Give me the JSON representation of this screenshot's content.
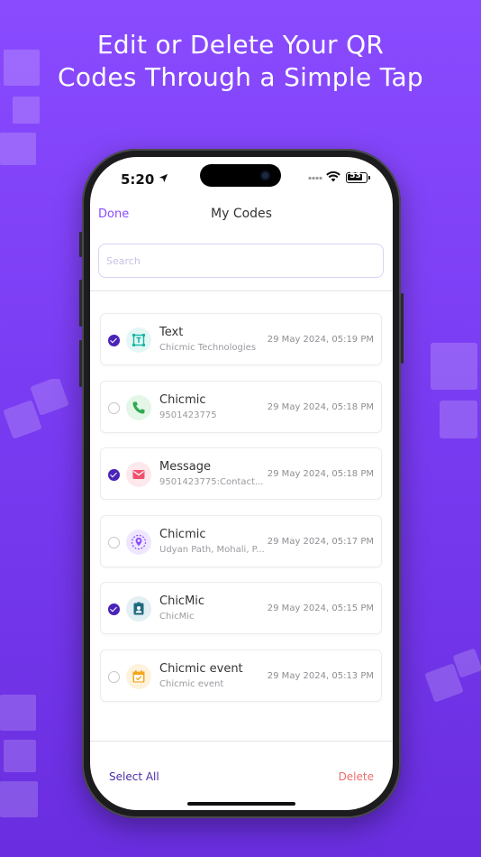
{
  "headline": {
    "line1": "Edit or Delete Your QR",
    "line2": "Codes Through a Simple Tap"
  },
  "status_bar": {
    "time": "5:20",
    "battery": "53",
    "icons": [
      "location-arrow-icon",
      "signal-icon",
      "wifi-icon",
      "battery-icon"
    ]
  },
  "nav": {
    "done_label": "Done",
    "title": "My Codes"
  },
  "search": {
    "placeholder": "Search",
    "value": ""
  },
  "codes": [
    {
      "title": "Text",
      "subtitle": "Chicmic Technologies",
      "date": "29 May 2024, 05:19 PM",
      "selected": true,
      "icon": "text-icon",
      "icon_color": "#19b5a6",
      "icon_bg": "#e4f7f5"
    },
    {
      "title": "Chicmic",
      "subtitle": "9501423775",
      "date": "29 May 2024, 05:18 PM",
      "selected": false,
      "icon": "phone-icon",
      "icon_color": "#2fa84f",
      "icon_bg": "#e3f6e7"
    },
    {
      "title": "Message",
      "subtitle": "9501423775:Contact...",
      "date": "29 May 2024, 05:18 PM",
      "selected": true,
      "icon": "message-icon",
      "icon_color": "#f0506e",
      "icon_bg": "#fde8ec"
    },
    {
      "title": "Chicmic",
      "subtitle": "Udyan Path, Mohali, P...",
      "date": "29 May 2024, 05:17 PM",
      "selected": false,
      "icon": "location-icon",
      "icon_color": "#8a4bff",
      "icon_bg": "#efe7ff"
    },
    {
      "title": "ChicMic",
      "subtitle": "ChicMic",
      "date": "29 May 2024, 05:15 PM",
      "selected": true,
      "icon": "contact-icon",
      "icon_color": "#1f6a80",
      "icon_bg": "#e2eff3"
    },
    {
      "title": "Chicmic event",
      "subtitle": "Chicmic event",
      "date": "29 May 2024, 05:13 PM",
      "selected": false,
      "icon": "calendar-icon",
      "icon_color": "#f2a81d",
      "icon_bg": "#fdf2dc"
    }
  ],
  "bottom_bar": {
    "select_all_label": "Select All",
    "delete_label": "Delete"
  },
  "colors": {
    "accent": "#8a4bff",
    "selected_check": "#4a23b8",
    "delete": "#f06d6d"
  }
}
